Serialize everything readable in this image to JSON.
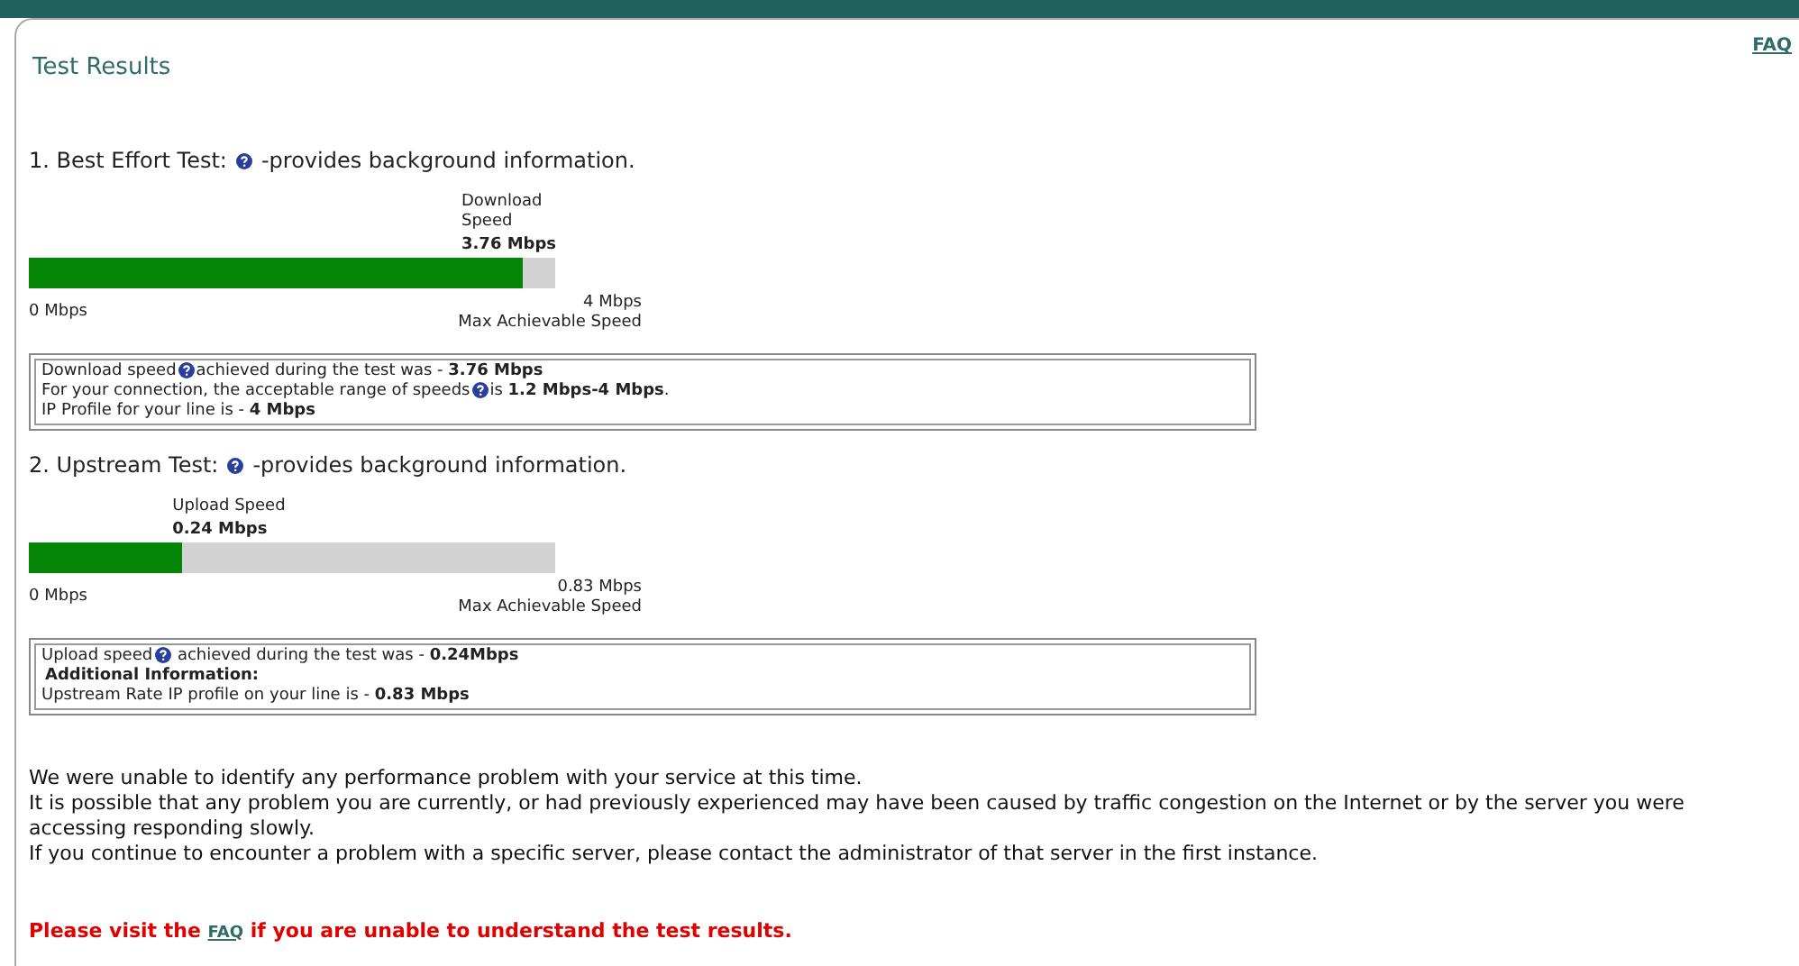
{
  "faq_link": "FAQ",
  "title": "Test Results",
  "tests": [
    {
      "heading": "1. Best Effort Test:",
      "heading_after": "-provides background information.",
      "gauge_label": [
        "Download",
        "Speed"
      ],
      "gauge_value": "3.76 Mbps",
      "level": 0.94,
      "min": "0 Mbps",
      "max": "4 Mbps",
      "max_caption": "Max Achievable Speed",
      "info": [
        {
          "kind": "text",
          "parts": [
            "Download speed",
            "achieved during the test was - **3.76 Mbps**"
          ]
        },
        {
          "kind": "text",
          "parts": [
            "For your connection, the acceptable range of speeds",
            "is **1.2 Mbps-4 Mbps**."
          ]
        },
        {
          "kind": "text",
          "parts": [
            "IP Profile for your line is - **4 Mbps**"
          ]
        }
      ]
    },
    {
      "heading": "2. Upstream Test:",
      "heading_after": "-provides background information.",
      "gauge_label": [
        "Upload Speed"
      ],
      "gauge_value": "0.24 Mbps",
      "level": 0.29,
      "min": "0 Mbps",
      "max": "0.83 Mbps",
      "max_caption": "Max Achievable Speed",
      "info": [
        {
          "kind": "text",
          "parts": [
            "Upload speed",
            " achieved during the test was - **0.24Mbps**"
          ]
        },
        {
          "kind": "heading",
          "parts": [
            "Additional Information:"
          ]
        },
        {
          "kind": "text",
          "parts": [
            "Upstream Rate IP profile on your line is - **0.83 Mbps**"
          ]
        }
      ]
    }
  ],
  "summary": [
    "We were unable to identify any performance problem with your service at this time.",
    "It is possible that any problem you are currently, or had previously experienced may have been caused by traffic congestion on the Internet or by the server you were accessing responding slowly.",
    "If you continue to encounter a problem with a specific server, please contact the administrator of that server in the first instance."
  ],
  "footer": {
    "before": "Please visit the",
    "link": "FAQ",
    "after": "if you are unable to understand the test results."
  }
}
